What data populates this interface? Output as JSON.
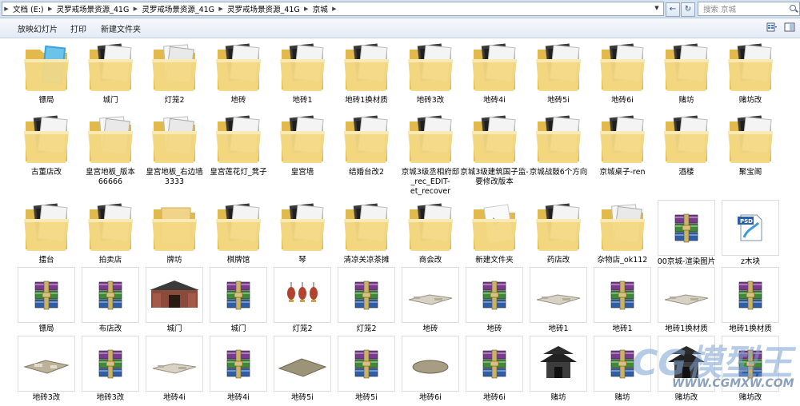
{
  "address": {
    "crumbs": [
      "文档 (E:)",
      "灵罗戒场景资源_41G",
      "灵罗戒场景资源_41G",
      "灵罗戒场景资源_41G",
      "京城"
    ],
    "back": "←",
    "refresh": "↻"
  },
  "search": {
    "placeholder": "搜索 京城"
  },
  "toolbar": {
    "slideshow": "放映幻灯片",
    "print": "打印",
    "new_folder": "新建文件夹"
  },
  "items": [
    {
      "label": "镖局",
      "kind": "folder",
      "variant": "blue"
    },
    {
      "label": "城门",
      "kind": "folder",
      "variant": "dark"
    },
    {
      "label": "灯笼2",
      "kind": "folder",
      "variant": "light"
    },
    {
      "label": "地砖",
      "kind": "folder",
      "variant": "dark"
    },
    {
      "label": "地砖1",
      "kind": "folder",
      "variant": "dark"
    },
    {
      "label": "地砖1换材质",
      "kind": "folder",
      "variant": "dark"
    },
    {
      "label": "地砖3改",
      "kind": "folder",
      "variant": "dark"
    },
    {
      "label": "地砖4i",
      "kind": "folder",
      "variant": "dark"
    },
    {
      "label": "地砖5i",
      "kind": "folder",
      "variant": "dark"
    },
    {
      "label": "地砖6i",
      "kind": "folder",
      "variant": "dark"
    },
    {
      "label": "赌坊",
      "kind": "folder",
      "variant": "dark"
    },
    {
      "label": "赌坊改",
      "kind": "folder",
      "variant": "dark"
    },
    {
      "label": "古董店改",
      "kind": "folder",
      "variant": "dark"
    },
    {
      "label": "皇宫地板_版本66666",
      "kind": "folder",
      "variant": "light"
    },
    {
      "label": "皇宫地板_右边墙3333",
      "kind": "folder",
      "variant": "light"
    },
    {
      "label": "皇宫莲花灯_凳子",
      "kind": "folder",
      "variant": "dark"
    },
    {
      "label": "皇宫墙",
      "kind": "folder",
      "variant": "dark"
    },
    {
      "label": "结婚台改2",
      "kind": "folder",
      "variant": "dark"
    },
    {
      "label": "京城3级丞相府邸_rec_EDIT-et_recover",
      "kind": "folder",
      "variant": "dark"
    },
    {
      "label": "京城3级建筑国子监-要修改版本",
      "kind": "folder",
      "variant": "dark"
    },
    {
      "label": "京城战鼓6个方向",
      "kind": "folder",
      "variant": "dark"
    },
    {
      "label": "京城桌子-ren",
      "kind": "folder",
      "variant": "dark"
    },
    {
      "label": "酒楼",
      "kind": "folder",
      "variant": "dark"
    },
    {
      "label": "聚宝阁",
      "kind": "folder",
      "variant": "dark"
    },
    {
      "label": "擂台",
      "kind": "folder",
      "variant": "dark"
    },
    {
      "label": "拍卖店",
      "kind": "folder",
      "variant": "dark"
    },
    {
      "label": "牌坊",
      "kind": "folder",
      "variant": "plain"
    },
    {
      "label": "棋牌馆",
      "kind": "folder",
      "variant": "dark"
    },
    {
      "label": "琴",
      "kind": "folder",
      "variant": "dark"
    },
    {
      "label": "清凉关凉茶摊",
      "kind": "folder",
      "variant": "dark"
    },
    {
      "label": "商会改",
      "kind": "folder",
      "variant": "dark"
    },
    {
      "label": "新建文件夹",
      "kind": "folder",
      "variant": "paper"
    },
    {
      "label": "药店改",
      "kind": "folder",
      "variant": "dark"
    },
    {
      "label": "杂物店_ok112",
      "kind": "folder",
      "variant": "light"
    },
    {
      "label": "00京城-渲染图片",
      "kind": "rar"
    },
    {
      "label": "z木块",
      "kind": "psd"
    },
    {
      "label": "镖局",
      "kind": "rar"
    },
    {
      "label": "布店改",
      "kind": "rar"
    },
    {
      "label": "城门",
      "kind": "gate"
    },
    {
      "label": "城门",
      "kind": "rar"
    },
    {
      "label": "灯笼2",
      "kind": "lantern"
    },
    {
      "label": "灯笼2",
      "kind": "rar"
    },
    {
      "label": "地砖",
      "kind": "tiles"
    },
    {
      "label": "地砖",
      "kind": "rar"
    },
    {
      "label": "地砖1",
      "kind": "tiles"
    },
    {
      "label": "地砖1",
      "kind": "rar"
    },
    {
      "label": "地砖1换材质",
      "kind": "tiles"
    },
    {
      "label": "地砖1换材质",
      "kind": "rar"
    },
    {
      "label": "地砖3改",
      "kind": "tiles2"
    },
    {
      "label": "地砖3改",
      "kind": "rar"
    },
    {
      "label": "地砖4i",
      "kind": "tiles"
    },
    {
      "label": "地砖4i",
      "kind": "rar"
    },
    {
      "label": "地砖5i",
      "kind": "slab"
    },
    {
      "label": "地砖5i",
      "kind": "rar"
    },
    {
      "label": "地砖6i",
      "kind": "disc"
    },
    {
      "label": "地砖6i",
      "kind": "rar"
    },
    {
      "label": "赌坊",
      "kind": "pavilion"
    },
    {
      "label": "赌坊",
      "kind": "rar"
    },
    {
      "label": "赌坊改",
      "kind": "pavilion"
    },
    {
      "label": "赌坊改",
      "kind": "rar"
    }
  ],
  "watermark": {
    "brand": "CG模型王",
    "url": "WWW.CGMXW.COM"
  },
  "colors": {
    "folder": "#f3d883",
    "folder_dark": "#e2b94c",
    "rar_purple": "#7a3a8e",
    "rar_green": "#3e8a3a",
    "rar_blue": "#2f5ea8"
  }
}
